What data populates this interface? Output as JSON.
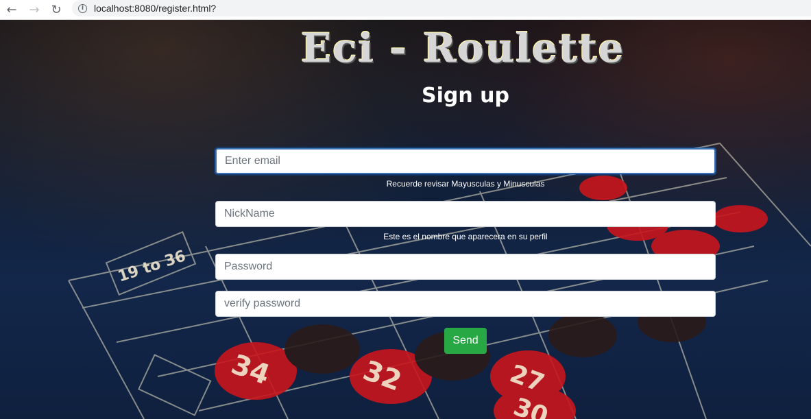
{
  "browser": {
    "url": "localhost:8080/register.html?",
    "back_icon": "arrow-left-icon",
    "forward_icon": "arrow-right-icon",
    "reload_icon": "reload-icon",
    "info_icon": "info-icon"
  },
  "logo": {
    "text": "Eci - Roulette"
  },
  "page": {
    "title": "Sign up"
  },
  "form": {
    "email_placeholder": "Enter email",
    "email_value": "",
    "email_help": "Recuerde revisar Mayusculas y Minusculas",
    "nickname_placeholder": "NickName",
    "nickname_value": "",
    "nickname_help": "Este es el nombre que aparecera en su perfil",
    "password_placeholder": "Password",
    "password_value": "",
    "verify_placeholder": "verify password",
    "verify_value": "",
    "send_label": "Send"
  },
  "colors": {
    "send_button": "#28a745",
    "focus_border": "#3b6fb3",
    "title_text": "#ffffff"
  }
}
